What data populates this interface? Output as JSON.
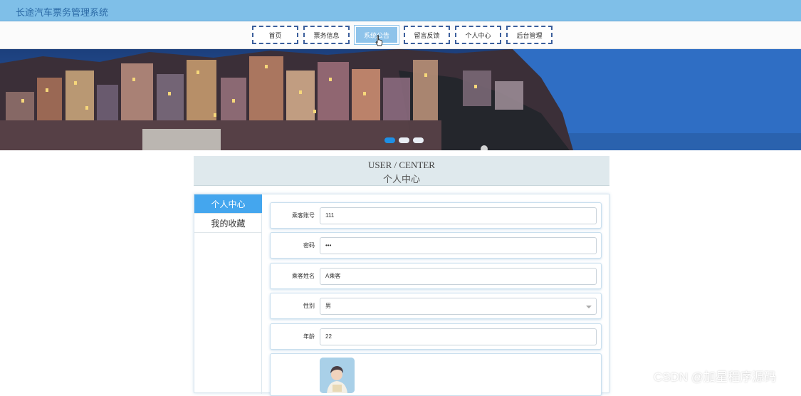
{
  "app": {
    "title": "长途汽车票务管理系统"
  },
  "nav": {
    "items": [
      {
        "label": "首页"
      },
      {
        "label": "票务信息"
      },
      {
        "label": "系统公告"
      },
      {
        "label": "留言反馈"
      },
      {
        "label": "个人中心"
      },
      {
        "label": "后台管理"
      }
    ],
    "active_index": 2
  },
  "banner": {
    "slide_count": 3,
    "active_slide": 0
  },
  "section": {
    "title_en": "USER / CENTER",
    "title_cn": "个人中心"
  },
  "sidebar": {
    "items": [
      {
        "label": "个人中心"
      },
      {
        "label": "我的收藏"
      }
    ],
    "active_index": 0
  },
  "form": {
    "fields": [
      {
        "label": "乘客账号",
        "value": "111"
      },
      {
        "label": "密码",
        "value": "•••"
      },
      {
        "label": "乘客姓名",
        "value": "A乘客"
      },
      {
        "label": "性别",
        "value": "男"
      },
      {
        "label": "年龄",
        "value": "22"
      }
    ]
  },
  "watermark": {
    "text": "CSDN @加星程序源码"
  },
  "colors": {
    "topbar": "#7fbfe8",
    "accent": "#44a6ee",
    "nav_border": "#3c5f9c",
    "section_bg": "#dfe9ed"
  }
}
